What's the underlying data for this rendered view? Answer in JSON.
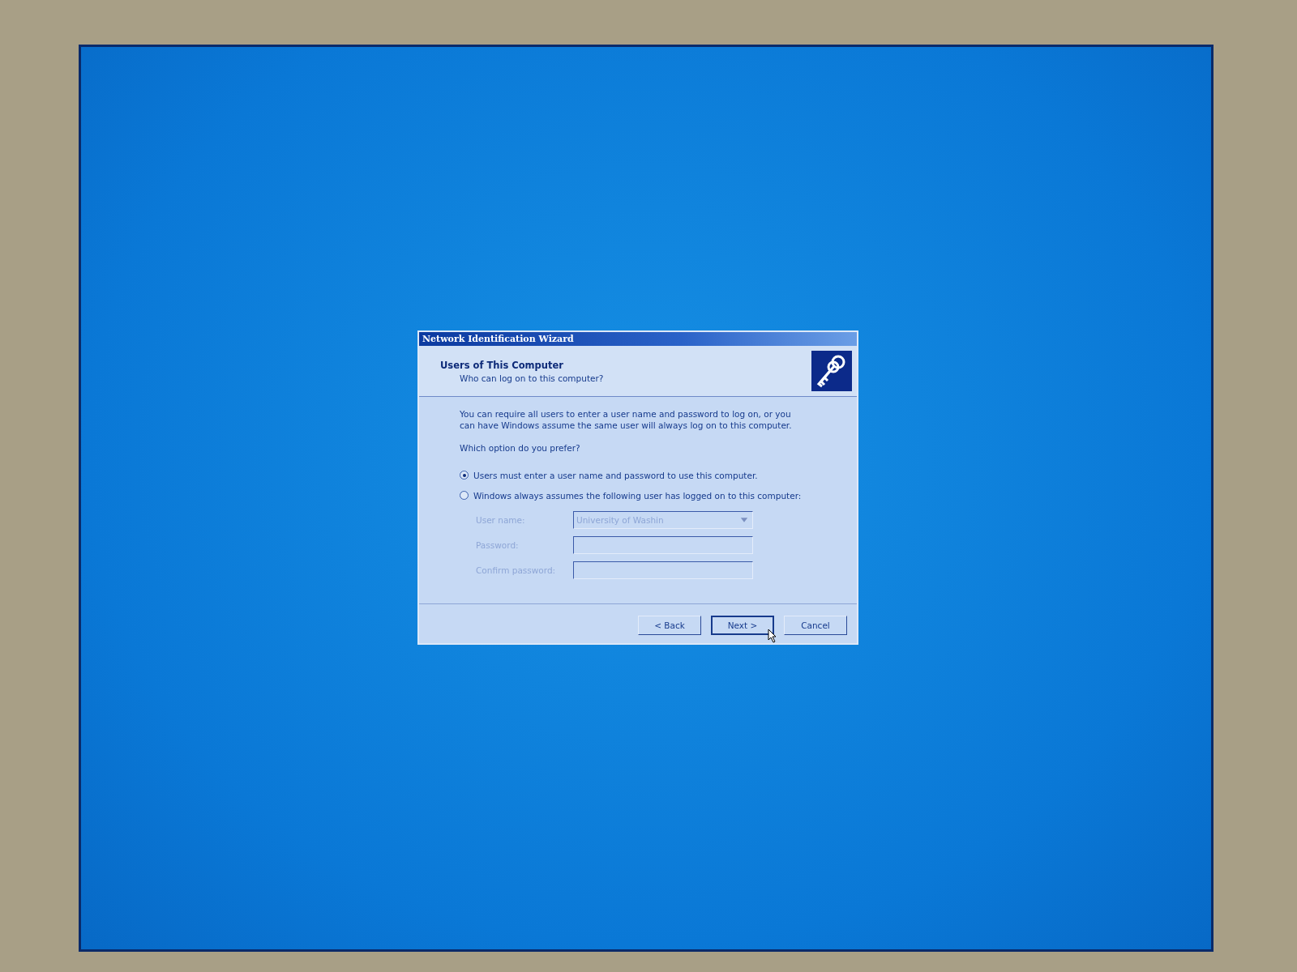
{
  "window": {
    "title": "Network Identification Wizard"
  },
  "header": {
    "title": "Users of This Computer",
    "subtitle": "Who can log on to this computer?"
  },
  "intro": "You can require all users to enter a user name and password to log on, or you can have Windows assume the same user will always log on to this computer.",
  "question": "Which option do you prefer?",
  "options": [
    {
      "label": "Users must enter a user name and password to use this computer.",
      "selected": true
    },
    {
      "label": "Windows always assumes the following user has logged on to this computer:",
      "selected": false
    }
  ],
  "fields": [
    {
      "kind": "dropdown",
      "label": "User name:",
      "value": "University of Washin",
      "disabled": true
    },
    {
      "kind": "password",
      "label": "Password:",
      "disabled": true
    },
    {
      "kind": "password",
      "label": "Confirm password:",
      "disabled": true
    }
  ],
  "buttons": [
    {
      "label": "< Back",
      "focused": false
    },
    {
      "label": "Next >",
      "focused": true
    },
    {
      "label": "Cancel",
      "focused": false
    }
  ]
}
